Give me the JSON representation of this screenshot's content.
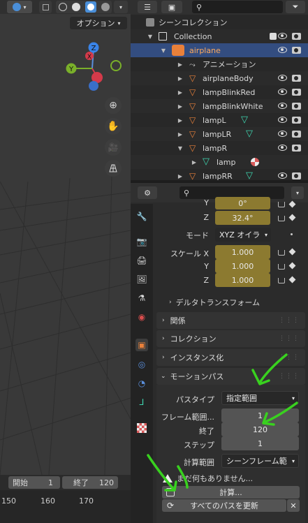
{
  "viewport": {
    "options_label": "オプション",
    "gizmo": {
      "z": "Z",
      "x": "X",
      "y": "Y"
    }
  },
  "outliner": {
    "search_placeholder": "",
    "rows": [
      {
        "label": "シーンコレクション",
        "type": "scene"
      },
      {
        "label": "Collection",
        "type": "collection"
      },
      {
        "label": "airplane",
        "type": "empty"
      },
      {
        "label": "アニメーション",
        "type": "anim"
      },
      {
        "label": "airplaneBody",
        "type": "mesh"
      },
      {
        "label": "lampBlinkRed",
        "type": "mesh"
      },
      {
        "label": "lampBlinkWhite",
        "type": "mesh"
      },
      {
        "label": "lampL",
        "type": "mesh"
      },
      {
        "label": "lampLR",
        "type": "mesh"
      },
      {
        "label": "lampR",
        "type": "mesh"
      },
      {
        "label": "lamp",
        "type": "mesh-data"
      },
      {
        "label": "lampRR",
        "type": "mesh"
      }
    ]
  },
  "properties": {
    "search_placeholder": "",
    "rotation": {
      "y_label": "Y",
      "y_value": "0°",
      "z_label": "Z",
      "z_value": "32.4°"
    },
    "mode_label": "モード",
    "mode_value": "XYZ オイラ",
    "scale": {
      "label_x": "スケール X",
      "label_y": "Y",
      "label_z": "Z",
      "x": "1.000",
      "y": "1.000",
      "z": "1.000"
    },
    "delta_transform": "デルタトランスフォーム",
    "panels": {
      "relations": "関係",
      "collections": "コレクション",
      "instancing": "インスタンス化",
      "motion_paths": "モーションパス"
    },
    "motion_paths": {
      "path_type_label": "パスタイプ",
      "path_type_value": "指定範囲",
      "frame_range_label": "フレーム範囲...",
      "frame_start": "1",
      "end_label": "終了",
      "frame_end": "120",
      "step_label": "ステップ",
      "step": "1",
      "calc_range_label": "計算範囲",
      "calc_range_value": "シーンフレーム範",
      "warning": "まだ何もありません...",
      "calculate_button": "計算...",
      "update_all_button": "すべてのパスを更新"
    }
  },
  "timeline": {
    "start_label": "開始",
    "start_value": "1",
    "end_label": "終了",
    "end_value": "120",
    "ticks": [
      "150",
      "160",
      "170"
    ]
  },
  "colors": {
    "selection": "#334d80",
    "gold_field": "#8c7a30",
    "annotation": "#39d11f",
    "object_orange": "#e8803a",
    "mesh_green": "#3fd6b0"
  }
}
